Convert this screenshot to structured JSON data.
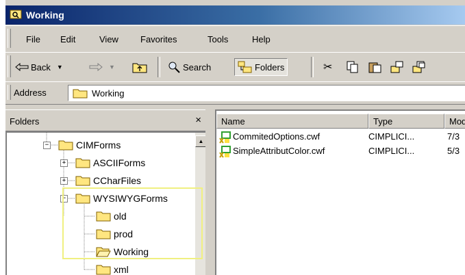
{
  "window": {
    "title": "Working"
  },
  "menu": [
    "File",
    "Edit",
    "View",
    "Favorites",
    "Tools",
    "Help"
  ],
  "toolbar": {
    "back_label": "Back",
    "search_label": "Search",
    "folders_label": "Folders"
  },
  "address": {
    "label": "Address",
    "value": "Working"
  },
  "folders_pane": {
    "title": "Folders",
    "close_glyph": "×",
    "nodes": [
      "CIMForms",
      "ASCIIForms",
      "CCharFiles",
      "WYSIWYGForms",
      "old",
      "prod",
      "Working",
      "xml"
    ]
  },
  "file_list": {
    "columns": [
      "Name",
      "Type",
      "Mod"
    ],
    "rows": [
      {
        "name": "CommitedOptions.cwf",
        "type": "CIMPLICI...",
        "modified": "7/3"
      },
      {
        "name": "SimpleAttributColor.cwf",
        "type": "CIMPLICI...",
        "modified": "5/3"
      }
    ]
  },
  "colors": {
    "title_start": "#0a246a",
    "title_end": "#a6caf0",
    "folder_yellow": "#ffe680",
    "highlight_box": "#f0f080"
  }
}
